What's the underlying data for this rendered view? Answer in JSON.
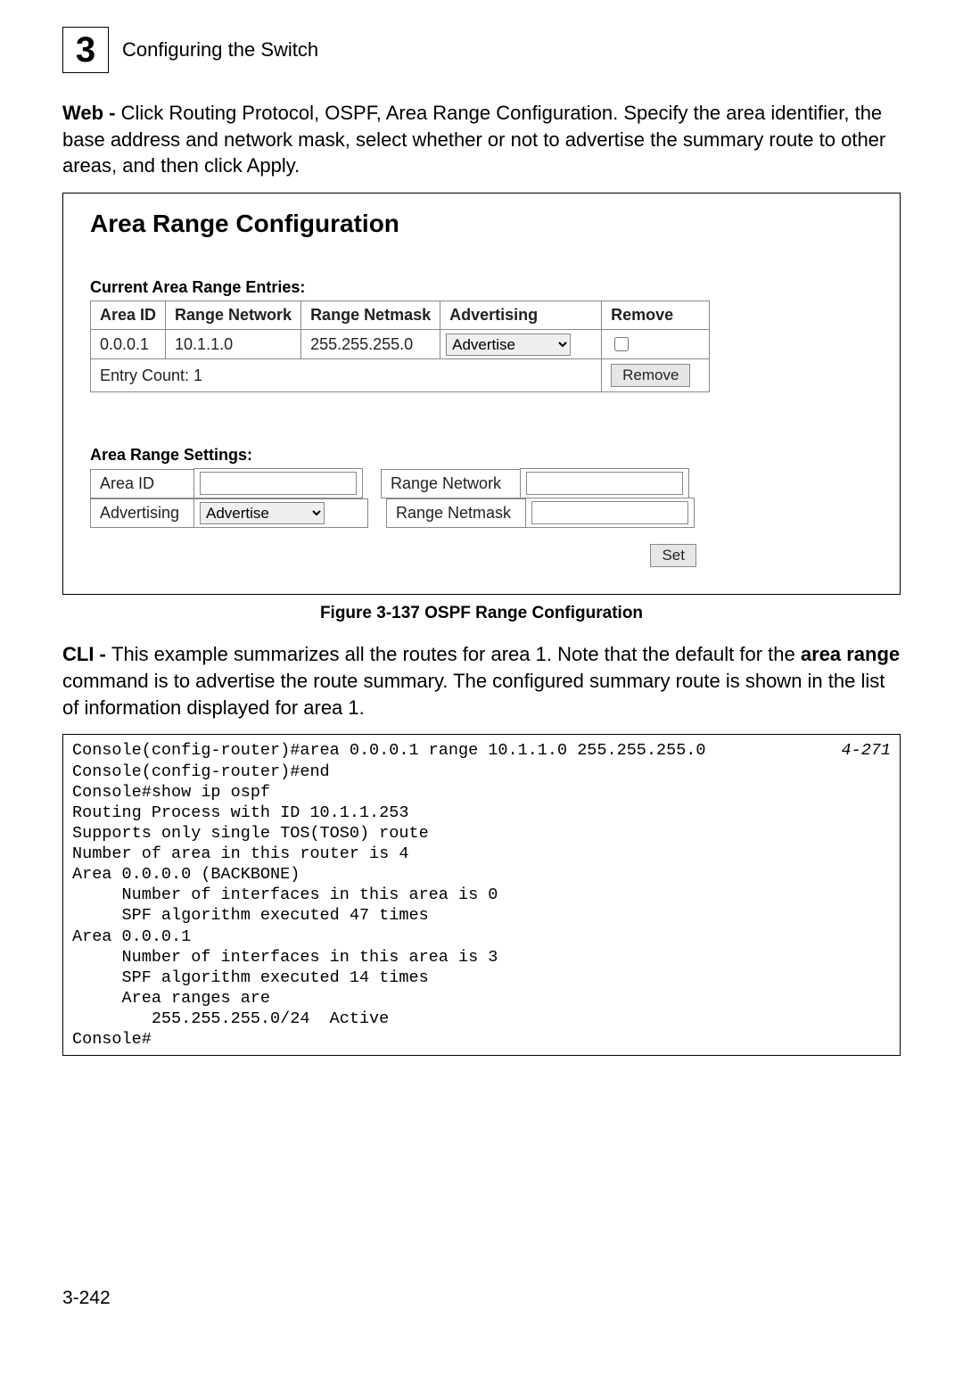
{
  "header": {
    "chapter_number": "3",
    "page_title": "Configuring the Switch"
  },
  "intro": {
    "lead_bold": "Web - ",
    "text": "Click Routing Protocol, OSPF, Area Range Configuration. Specify the area identifier, the base address and network mask, select whether or not to advertise the summary route to other areas, and then click Apply."
  },
  "figure": {
    "title": "Area Range Configuration",
    "entries_label": "Current Area Range Entries:",
    "columns": {
      "area_id": "Area ID",
      "range_network": "Range Network",
      "range_netmask": "Range Netmask",
      "advertising": "Advertising",
      "remove": "Remove"
    },
    "rows": [
      {
        "area_id": "0.0.0.1",
        "range_network": "10.1.1.0",
        "range_netmask": "255.255.255.0",
        "advertising_selected": "Advertise",
        "remove_checked": false
      }
    ],
    "entry_count_label": "Entry Count: 1",
    "remove_button": "Remove",
    "settings_label": "Area Range Settings:",
    "settings": {
      "area_id_label": "Area ID",
      "area_id_value": "",
      "advertising_label": "Advertising",
      "advertising_selected": "Advertise",
      "range_network_label": "Range Network",
      "range_network_value": "",
      "range_netmask_label": "Range Netmask",
      "range_netmask_value": ""
    },
    "set_button": "Set",
    "caption": "Figure 3-137   OSPF Range Configuration"
  },
  "cli_intro": {
    "lead_bold": "CLI - ",
    "part1": "This example summarizes all the routes for area 1. Note that the default for the ",
    "bold_term": "area range",
    "part2": " command is to advertise the route summary. The configured summary route is shown in the list of information displayed for area 1."
  },
  "cli": {
    "ref": "4-271",
    "line1": "Console(config-router)#area 0.0.0.1 range 10.1.1.0 255.255.255.0",
    "rest": "Console(config-router)#end\nConsole#show ip ospf\nRouting Process with ID 10.1.1.253\nSupports only single TOS(TOS0) route\nNumber of area in this router is 4\nArea 0.0.0.0 (BACKBONE)\n     Number of interfaces in this area is 0\n     SPF algorithm executed 47 times\nArea 0.0.0.1\n     Number of interfaces in this area is 3\n     SPF algorithm executed 14 times\n     Area ranges are\n        255.255.255.0/24  Active\nConsole#"
  },
  "page_number": "3-242"
}
